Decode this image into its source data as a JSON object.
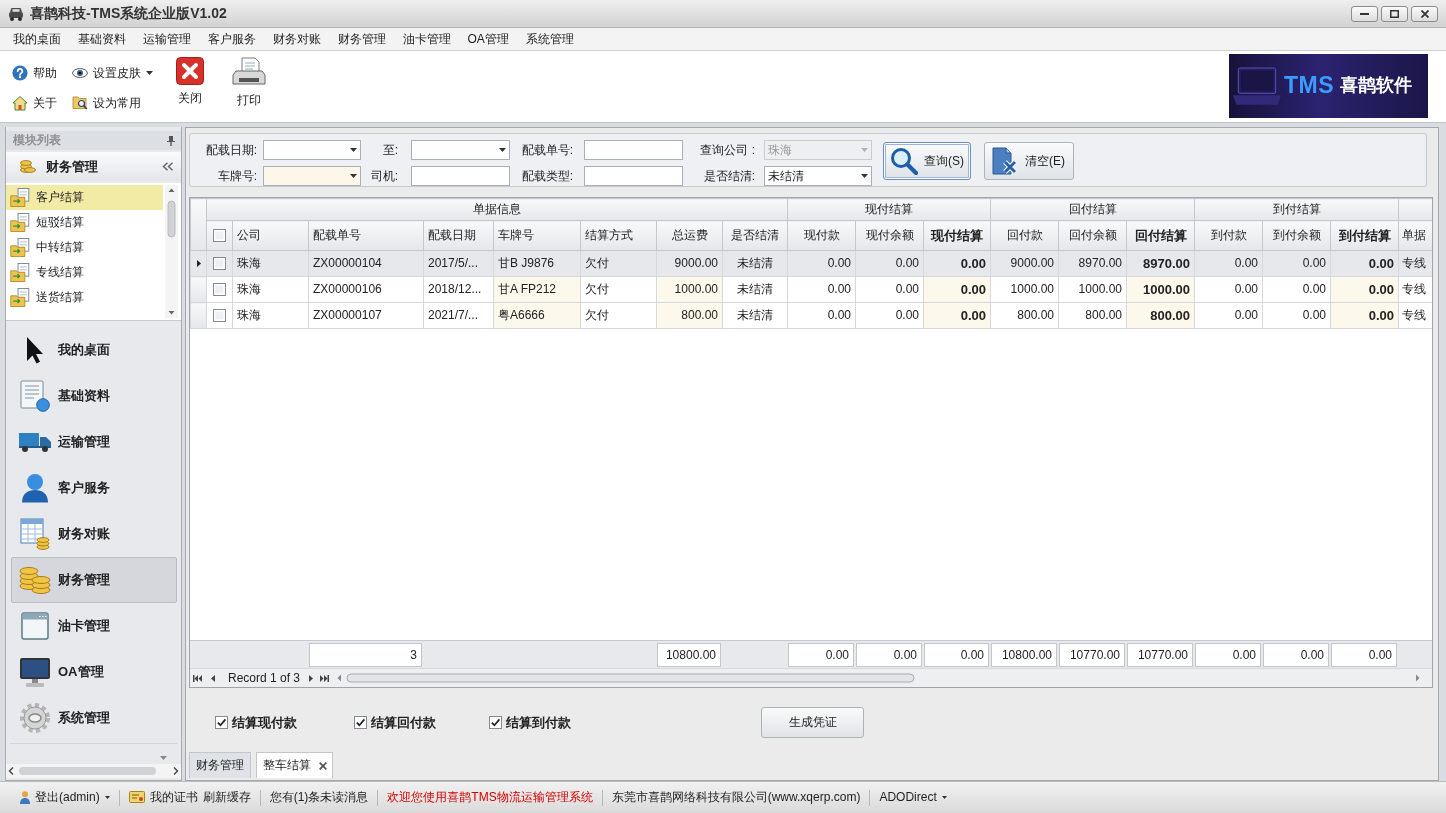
{
  "window": {
    "title": "喜鹊科技-TMS系统企业版V1.02"
  },
  "menu": [
    "我的桌面",
    "基础资料",
    "运输管理",
    "客户服务",
    "财务对账",
    "财务管理",
    "油卡管理",
    "OA管理",
    "系统管理"
  ],
  "toolbar": {
    "small": [
      {
        "label": "帮助",
        "dropdown": false
      },
      {
        "label": "设置皮肤",
        "dropdown": true
      },
      {
        "label": "关于",
        "dropdown": false
      },
      {
        "label": "设为常用",
        "dropdown": false
      }
    ],
    "large": [
      "关闭",
      "打印"
    ],
    "logo": {
      "brand": "TMS",
      "name": "喜鹊软件"
    }
  },
  "sidebar": {
    "title": "模块列表",
    "group": "财务管理",
    "items": [
      {
        "label": "客户结算",
        "selected": true
      },
      {
        "label": "短驳结算",
        "selected": false
      },
      {
        "label": "中转结算",
        "selected": false
      },
      {
        "label": "专线结算",
        "selected": false
      },
      {
        "label": "送货结算",
        "selected": false
      }
    ],
    "nav": [
      {
        "label": "我的桌面",
        "selected": false
      },
      {
        "label": "基础资料",
        "selected": false
      },
      {
        "label": "运输管理",
        "selected": false
      },
      {
        "label": "客户服务",
        "selected": false
      },
      {
        "label": "财务对账",
        "selected": false
      },
      {
        "label": "财务管理",
        "selected": true
      },
      {
        "label": "油卡管理",
        "selected": false
      },
      {
        "label": "OA管理",
        "selected": false
      },
      {
        "label": "系统管理",
        "selected": false
      }
    ]
  },
  "filters": {
    "rows": [
      [
        {
          "label": "配载日期:",
          "kind": "dropdown",
          "disabled": false,
          "highlighted": false
        },
        {
          "label": "至:",
          "kind": "dropdown",
          "disabled": false,
          "highlighted": false
        },
        {
          "label": "配载单号:",
          "kind": "input",
          "disabled": false,
          "highlighted": false
        },
        {
          "label": "查询公司 :",
          "kind": "dropdown",
          "value": "珠海",
          "disabled": true,
          "highlighted": false
        }
      ],
      [
        {
          "label": "车牌号:",
          "kind": "dropdown",
          "disabled": false,
          "highlighted": true
        },
        {
          "label": "司机:",
          "kind": "input",
          "disabled": false,
          "highlighted": false
        },
        {
          "label": "配载类型:",
          "kind": "input",
          "disabled": false,
          "highlighted": false
        },
        {
          "label": "是否结清:",
          "kind": "dropdown",
          "value": "未结清",
          "disabled": false,
          "highlighted": false
        }
      ]
    ]
  },
  "filter_buttons": [
    {
      "label": "查询(S)",
      "focused": true
    },
    {
      "label": "清空(E)",
      "focused": false
    }
  ],
  "grid": {
    "select_all": {
      "checked": false
    },
    "groups": [
      {
        "label": "单据信息",
        "columns": [
          {
            "label": "公司",
            "kind": "text",
            "highlighted": false
          },
          {
            "label": "配载单号",
            "kind": "text",
            "highlighted": false,
            "summary": "3"
          },
          {
            "label": "配载日期",
            "kind": "text",
            "highlighted": false
          },
          {
            "label": "车牌号",
            "kind": "text",
            "highlighted": true
          },
          {
            "label": "结算方式",
            "kind": "text",
            "highlighted": false
          },
          {
            "label": "总运费",
            "kind": "money",
            "highlighted": true,
            "summary": "10800.00"
          },
          {
            "label": "是否结清",
            "kind": "status",
            "highlighted": false
          }
        ]
      },
      {
        "label": "现付结算",
        "columns": [
          {
            "label": "现付款",
            "kind": "money",
            "highlighted": false,
            "summary": "0.00"
          },
          {
            "label": "现付余额",
            "kind": "money",
            "highlighted": false,
            "summary": "0.00"
          },
          {
            "label": "现付结算",
            "kind": "total",
            "highlighted": true,
            "summary": "0.00"
          }
        ]
      },
      {
        "label": "回付结算",
        "columns": [
          {
            "label": "回付款",
            "kind": "money",
            "highlighted": false,
            "summary": "10800.00"
          },
          {
            "label": "回付余额",
            "kind": "money",
            "highlighted": false,
            "summary": "10770.00"
          },
          {
            "label": "回付结算",
            "kind": "total",
            "highlighted": true,
            "summary": "10770.00"
          }
        ]
      },
      {
        "label": "到付结算",
        "columns": [
          {
            "label": "到付款",
            "kind": "money",
            "highlighted": false,
            "summary": "0.00"
          },
          {
            "label": "到付余额",
            "kind": "money",
            "highlighted": false,
            "summary": "0.00"
          },
          {
            "label": "到付结算",
            "kind": "total",
            "highlighted": true,
            "summary": "0.00"
          }
        ]
      },
      {
        "columns": [
          {
            "label": "单据",
            "kind": "text",
            "highlighted": false
          }
        ]
      }
    ],
    "rows": [
      {
        "selected": true,
        "checked": false,
        "cells": [
          "珠海",
          "ZX00000104",
          "2017/5/...",
          "甘B J9876",
          "欠付",
          "9000.00",
          "未结清",
          "0.00",
          "0.00",
          "0.00",
          "9000.00",
          "8970.00",
          "8970.00",
          "0.00",
          "0.00",
          "0.00",
          "专线"
        ]
      },
      {
        "selected": false,
        "checked": false,
        "cells": [
          "珠海",
          "ZX00000106",
          "2018/12...",
          "甘A FP212",
          "欠付",
          "1000.00",
          "未结清",
          "0.00",
          "0.00",
          "0.00",
          "1000.00",
          "1000.00",
          "1000.00",
          "0.00",
          "0.00",
          "0.00",
          "专线"
        ]
      },
      {
        "selected": false,
        "checked": false,
        "cells": [
          "珠海",
          "ZX00000107",
          "2021/7/...",
          "粤A6666",
          "欠付",
          "800.00",
          "未结清",
          "0.00",
          "0.00",
          "0.00",
          "800.00",
          "800.00",
          "800.00",
          "0.00",
          "0.00",
          "0.00",
          "专线"
        ]
      }
    ],
    "navigator": {
      "record": "Record 1 of 3"
    }
  },
  "options": [
    {
      "label": "结算现付款",
      "checked": true
    },
    {
      "label": "结算回付款",
      "checked": true
    },
    {
      "label": "结算到付款",
      "checked": true
    }
  ],
  "action": "生成凭证",
  "tabs": [
    {
      "label": "财务管理",
      "selected": false,
      "closable": false
    },
    {
      "label": "整车结算",
      "selected": true,
      "closable": true
    }
  ],
  "status_bar": [
    [
      {
        "text": "登出(admin)",
        "dropdown": true
      }
    ],
    [
      {
        "text": "我的证书",
        "dropdown": false
      },
      {
        "text": "刷新缓存",
        "dropdown": false
      }
    ],
    [
      {
        "text": "您有(1)条未读消息",
        "dropdown": false
      }
    ],
    [
      {
        "text": "欢迎您使用喜鹊TMS物流运输管理系统",
        "dropdown": false,
        "color": "#d40000"
      }
    ],
    [
      {
        "text": "东莞市喜鹊网络科技有限公司(www.xqerp.com)",
        "dropdown": false
      }
    ],
    [
      {
        "text": "ADODirect",
        "dropdown": true
      }
    ]
  ]
}
